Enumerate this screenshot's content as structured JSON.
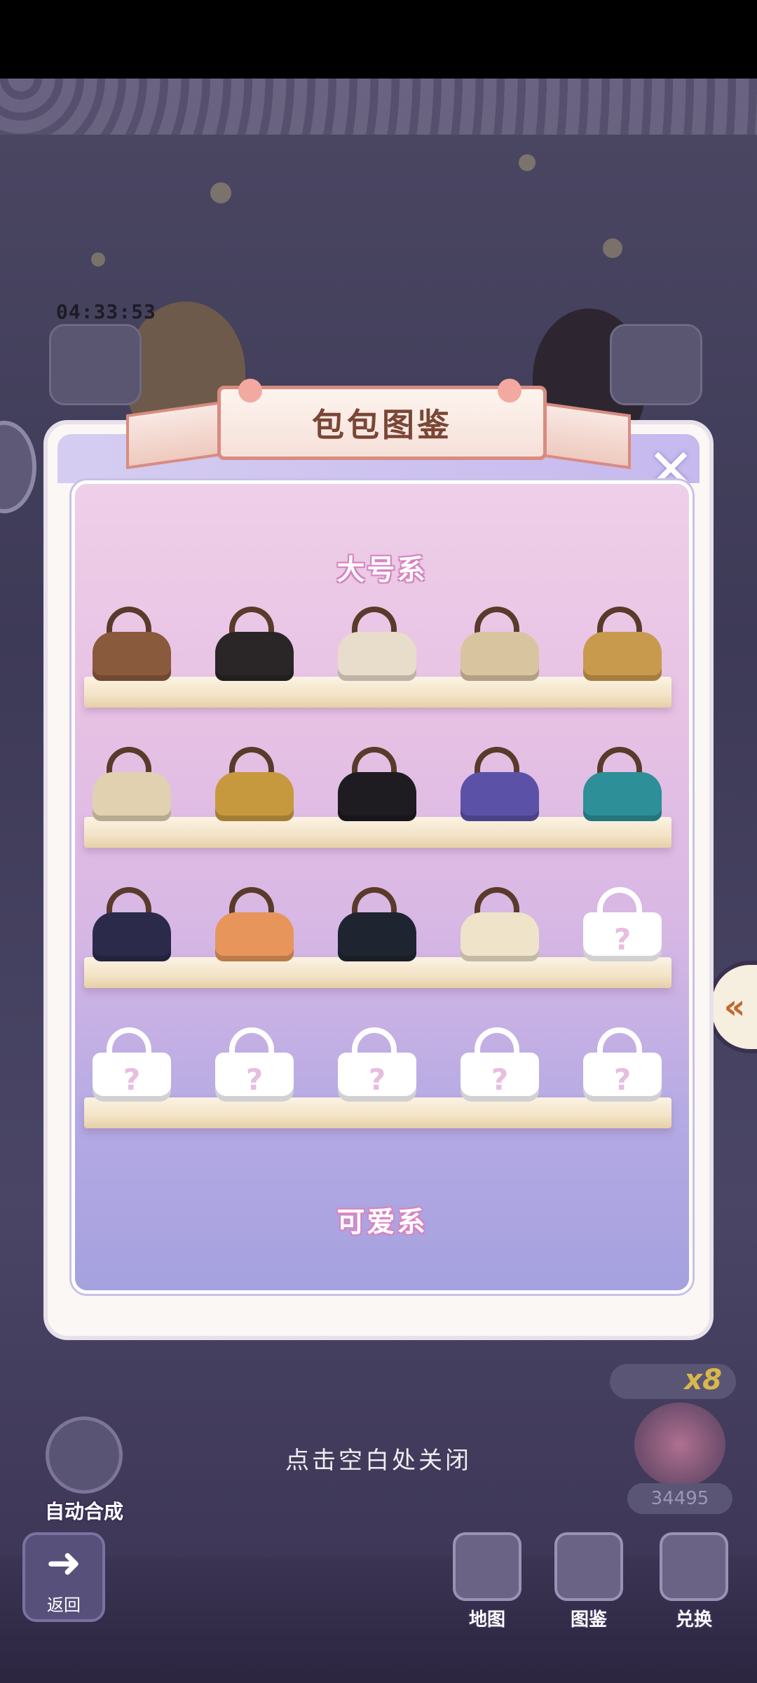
{
  "hud": {
    "timer": "04:33:53",
    "count_badge": "x8",
    "coins": "34495",
    "side_tab_glyph": "«"
  },
  "modal": {
    "title": "包包图鉴",
    "close_icon": "close-x-icon",
    "sections": [
      {
        "title": "大号系"
      },
      {
        "title": "可爱系"
      }
    ],
    "shelves": [
      {
        "bags": [
          {
            "name": "bag",
            "color": "#8a5a3c",
            "locked": false
          },
          {
            "name": "bag",
            "color": "#2a2628",
            "locked": false
          },
          {
            "name": "bag",
            "color": "#e8dccb",
            "locked": false
          },
          {
            "name": "bag",
            "color": "#d9c4a0",
            "locked": false
          },
          {
            "name": "bag",
            "color": "#c79a4e",
            "locked": false
          }
        ]
      },
      {
        "bags": [
          {
            "name": "bag",
            "color": "#e2d1b0",
            "locked": false
          },
          {
            "name": "bag",
            "color": "#c7993f",
            "locked": false
          },
          {
            "name": "bag",
            "color": "#1e1c20",
            "locked": false
          },
          {
            "name": "bag",
            "color": "#5b52a8",
            "locked": false
          },
          {
            "name": "bag",
            "color": "#2d8f98",
            "locked": false
          }
        ]
      },
      {
        "bags": [
          {
            "name": "bag",
            "color": "#2c2a4a",
            "locked": false
          },
          {
            "name": "bag",
            "color": "#e7955a",
            "locked": false
          },
          {
            "name": "bag",
            "color": "#1f2530",
            "locked": false
          },
          {
            "name": "bag",
            "color": "#efe3c9",
            "locked": false
          },
          {
            "name": "bag",
            "locked": true,
            "label": "?"
          }
        ]
      },
      {
        "bags": [
          {
            "name": "bag",
            "locked": true,
            "label": "?"
          },
          {
            "name": "bag",
            "locked": true,
            "label": "?"
          },
          {
            "name": "bag",
            "locked": true,
            "label": "?"
          },
          {
            "name": "bag",
            "locked": true,
            "label": "?"
          },
          {
            "name": "bag",
            "locked": true,
            "label": "?"
          }
        ]
      }
    ]
  },
  "tap_to_close": "点击空白处关闭",
  "auto_merge_label": "自动合成",
  "back_label": "返回",
  "nav": [
    {
      "label": "地图",
      "icon": "map-icon"
    },
    {
      "label": "图鉴",
      "icon": "catalog-bag-icon"
    },
    {
      "label": "兑换",
      "icon": "shop-icon"
    }
  ]
}
